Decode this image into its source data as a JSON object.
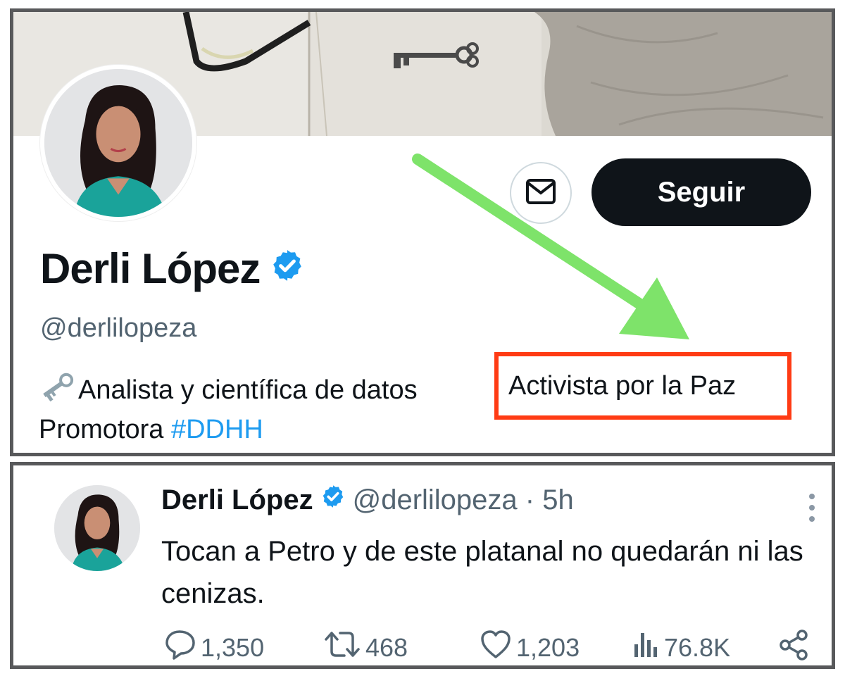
{
  "profile": {
    "display_name": "Derli López",
    "handle": "@derlilopeza",
    "verified": true,
    "follow_label": "Seguir",
    "bio_line1": "Analista y científica de datos",
    "bio_highlight": "Activista por la Paz",
    "bio_line2_prefix": "Promotora ",
    "bio_hashtag": "#DDHH",
    "icons": [
      "message-icon",
      "key-emoji-icon",
      "verified-badge-icon"
    ]
  },
  "annotation": {
    "arrow_color": "#7ee36a",
    "box_color": "#ff3b14"
  },
  "tweet": {
    "display_name": "Derli López",
    "handle_time": "@derlilopeza · 5h",
    "text": "Tocan a Petro y de este platanal no quedarán ni las cenizas.",
    "replies": "1,350",
    "retweets": "468",
    "likes": "1,203",
    "views": "76.8K",
    "icons": [
      "reply-icon",
      "retweet-icon",
      "like-icon",
      "views-icon",
      "share-icon",
      "more-options-icon"
    ]
  },
  "colors": {
    "accent": "#1d9bf0",
    "text": "#0f1419",
    "muted": "#536471"
  }
}
